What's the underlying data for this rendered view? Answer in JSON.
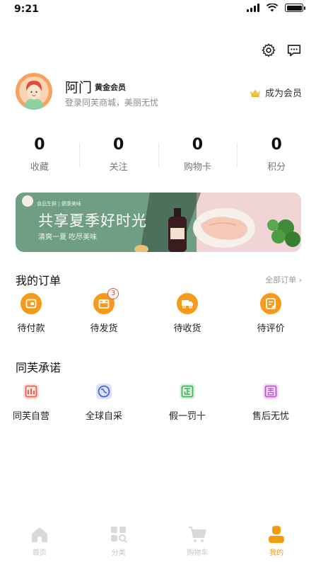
{
  "status_bar": {
    "time": "9:21"
  },
  "header_actions": {
    "settings_icon": "gear-icon",
    "messages_icon": "message-icon"
  },
  "profile": {
    "name": "阿门",
    "member_level": "黄金会员",
    "tagline": "登录同芙商城，美丽无忧",
    "become_member": "成为会员"
  },
  "stats": [
    {
      "value": "0",
      "label": "收藏"
    },
    {
      "value": "0",
      "label": "关注"
    },
    {
      "value": "0",
      "label": "购物卡"
    },
    {
      "value": "0",
      "label": "积分"
    }
  ],
  "banner": {
    "small_text": "食品生鲜 | 健康美味",
    "title": "共享夏季好时光",
    "subtitle": "清爽一夏 吃尽美味"
  },
  "orders": {
    "title": "我的订单",
    "all_link": "全部订单 ›",
    "items": [
      {
        "label": "待付款",
        "icon": "wallet-icon"
      },
      {
        "label": "待发货",
        "icon": "box-icon",
        "badge": "3"
      },
      {
        "label": "待收货",
        "icon": "truck-icon"
      },
      {
        "label": "待评价",
        "icon": "review-icon"
      }
    ]
  },
  "promise": {
    "title": "同芙承诺",
    "items": [
      {
        "label": "同芙自营",
        "icon": "store-icon"
      },
      {
        "label": "全球自采",
        "icon": "globe-icon"
      },
      {
        "label": "假一罚十",
        "icon": "authentic-icon"
      },
      {
        "label": "售后无忧",
        "icon": "aftersale-icon"
      }
    ]
  },
  "bottom_nav": [
    {
      "label": "首页",
      "icon": "home-icon"
    },
    {
      "label": "分类",
      "icon": "category-icon"
    },
    {
      "label": "购物车",
      "icon": "cart-icon"
    },
    {
      "label": "我的",
      "icon": "profile-icon",
      "active": true
    }
  ],
  "colors": {
    "accent_orange": "#f39c12",
    "badge_red": "#e94b3c",
    "banner_green": "#6f9e82"
  }
}
